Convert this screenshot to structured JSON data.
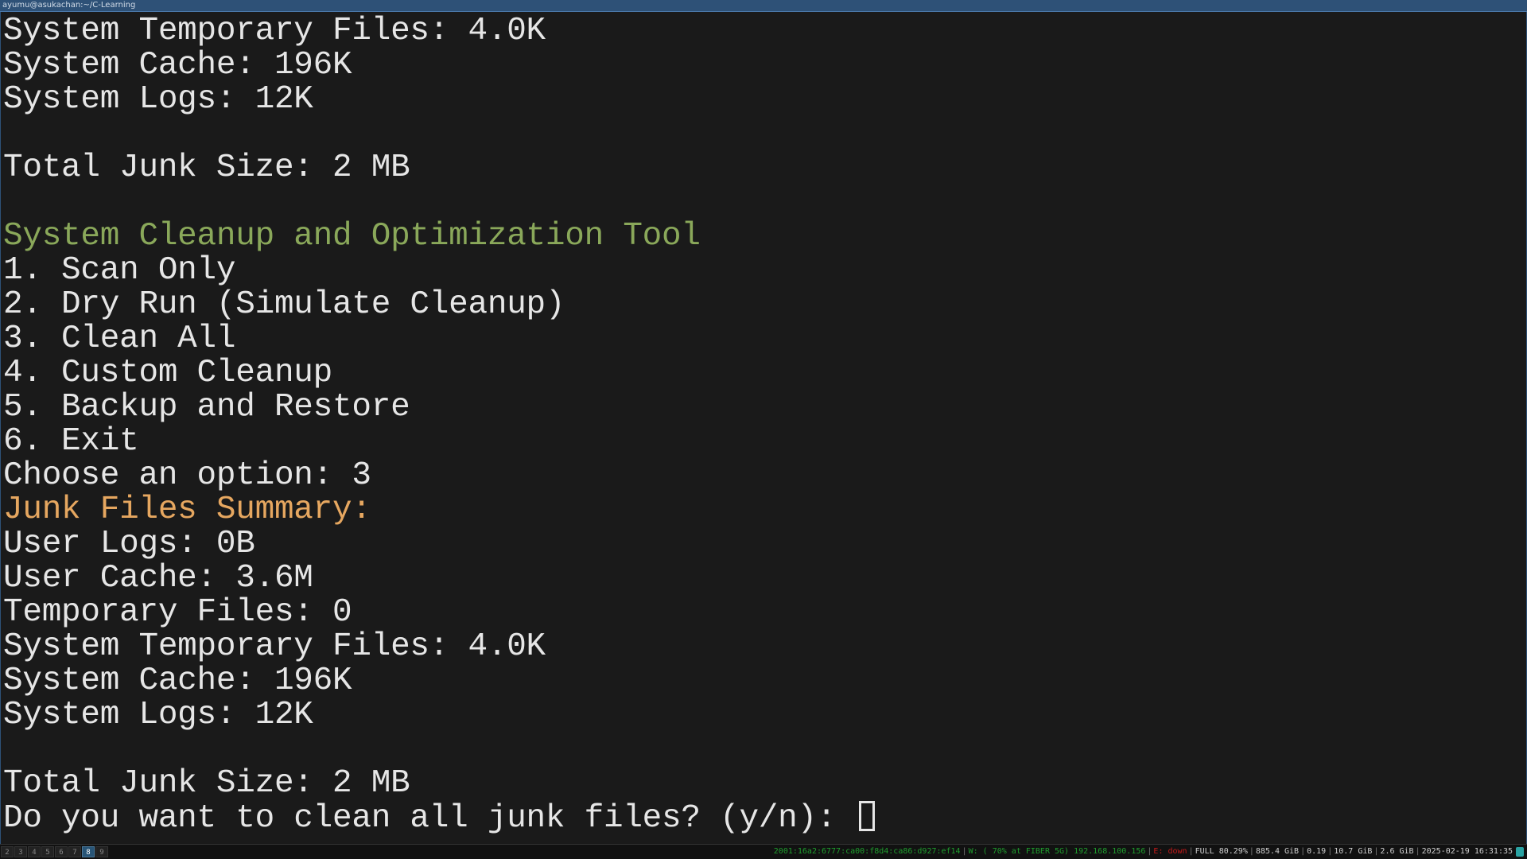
{
  "window": {
    "title": "ayumu@asukachan:~/C-Learning"
  },
  "terminal": {
    "lines": [
      {
        "text": "System Temporary Files: 4.0K",
        "color": "default"
      },
      {
        "text": "System Cache: 196K",
        "color": "default"
      },
      {
        "text": "System Logs: 12K",
        "color": "default"
      },
      {
        "text": "",
        "color": "default"
      },
      {
        "text": "Total Junk Size: 2 MB",
        "color": "default"
      },
      {
        "text": "",
        "color": "default"
      },
      {
        "text": "System Cleanup and Optimization Tool",
        "color": "green"
      },
      {
        "text": "1. Scan Only",
        "color": "default"
      },
      {
        "text": "2. Dry Run (Simulate Cleanup)",
        "color": "default"
      },
      {
        "text": "3. Clean All",
        "color": "default"
      },
      {
        "text": "4. Custom Cleanup",
        "color": "default"
      },
      {
        "text": "5. Backup and Restore",
        "color": "default"
      },
      {
        "text": "6. Exit",
        "color": "default"
      },
      {
        "text": "Choose an option: 3",
        "color": "default"
      },
      {
        "text": "Junk Files Summary:",
        "color": "orange"
      },
      {
        "text": "User Logs: 0B",
        "color": "default"
      },
      {
        "text": "User Cache: 3.6M",
        "color": "default"
      },
      {
        "text": "Temporary Files: 0",
        "color": "default"
      },
      {
        "text": "System Temporary Files: 4.0K",
        "color": "default"
      },
      {
        "text": "System Cache: 196K",
        "color": "default"
      },
      {
        "text": "System Logs: 12K",
        "color": "default"
      },
      {
        "text": "",
        "color": "default"
      },
      {
        "text": "Total Junk Size: 2 MB",
        "color": "default"
      }
    ],
    "prompt": "Do you want to clean all junk files? (y/n): ",
    "colors": {
      "background": "#1a1a1a",
      "default": "#e6e6e6",
      "green": "#8aa85a",
      "orange": "#e6a760"
    }
  },
  "statusbar": {
    "workspaces": [
      "2",
      "3",
      "4",
      "5",
      "6",
      "7",
      "8",
      "9"
    ],
    "active_workspace": "8",
    "ipv6": "2001:16a2:6777:ca00:f8d4:ca86:d927:ef14",
    "wifi": "W: ( 70% at FIBER 5G) 192.168.100.156",
    "ethernet": "E: down",
    "disk": "FULL 80.29%",
    "disk_free": "885.4 GiB",
    "load": "0.19",
    "memory": "10.7 GiB",
    "swap": "2.6 GiB",
    "datetime": "2025-02-19 16:31:35",
    "tray_icon": "network-tray-icon"
  }
}
